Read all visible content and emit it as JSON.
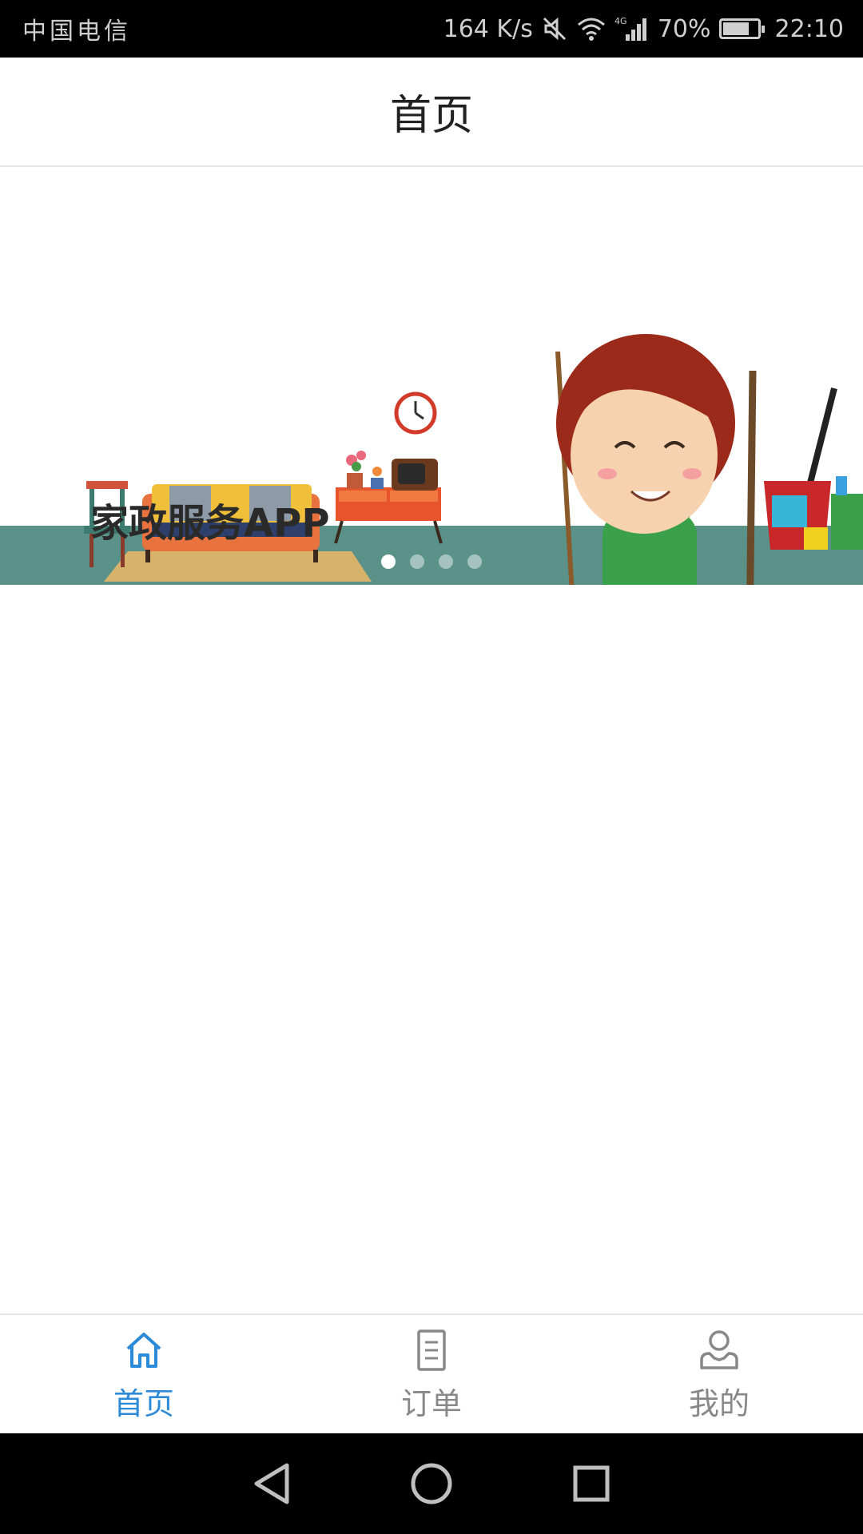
{
  "status_bar": {
    "carrier": "中国电信",
    "net_speed": "164 K/s",
    "network_type": "4G",
    "battery": "70%",
    "time": "22:10",
    "icons": [
      "mute-icon",
      "wifi-icon",
      "signal-icon",
      "battery-icon"
    ]
  },
  "header": {
    "title": "首页"
  },
  "banner": {
    "title": "家政服务APP",
    "slide_count": 4,
    "active_slide": 1
  },
  "bottom_nav": {
    "items": [
      {
        "label": "首页",
        "icon": "home-icon",
        "active": true
      },
      {
        "label": "订单",
        "icon": "document-icon",
        "active": false
      },
      {
        "label": "我的",
        "icon": "user-icon",
        "active": false
      }
    ]
  },
  "system_nav": {
    "icons": [
      "back-icon",
      "home-circle-icon",
      "recents-icon"
    ]
  },
  "colors": {
    "accent": "#2d8ad8",
    "inactive": "#888888",
    "floor": "#5a9289"
  }
}
